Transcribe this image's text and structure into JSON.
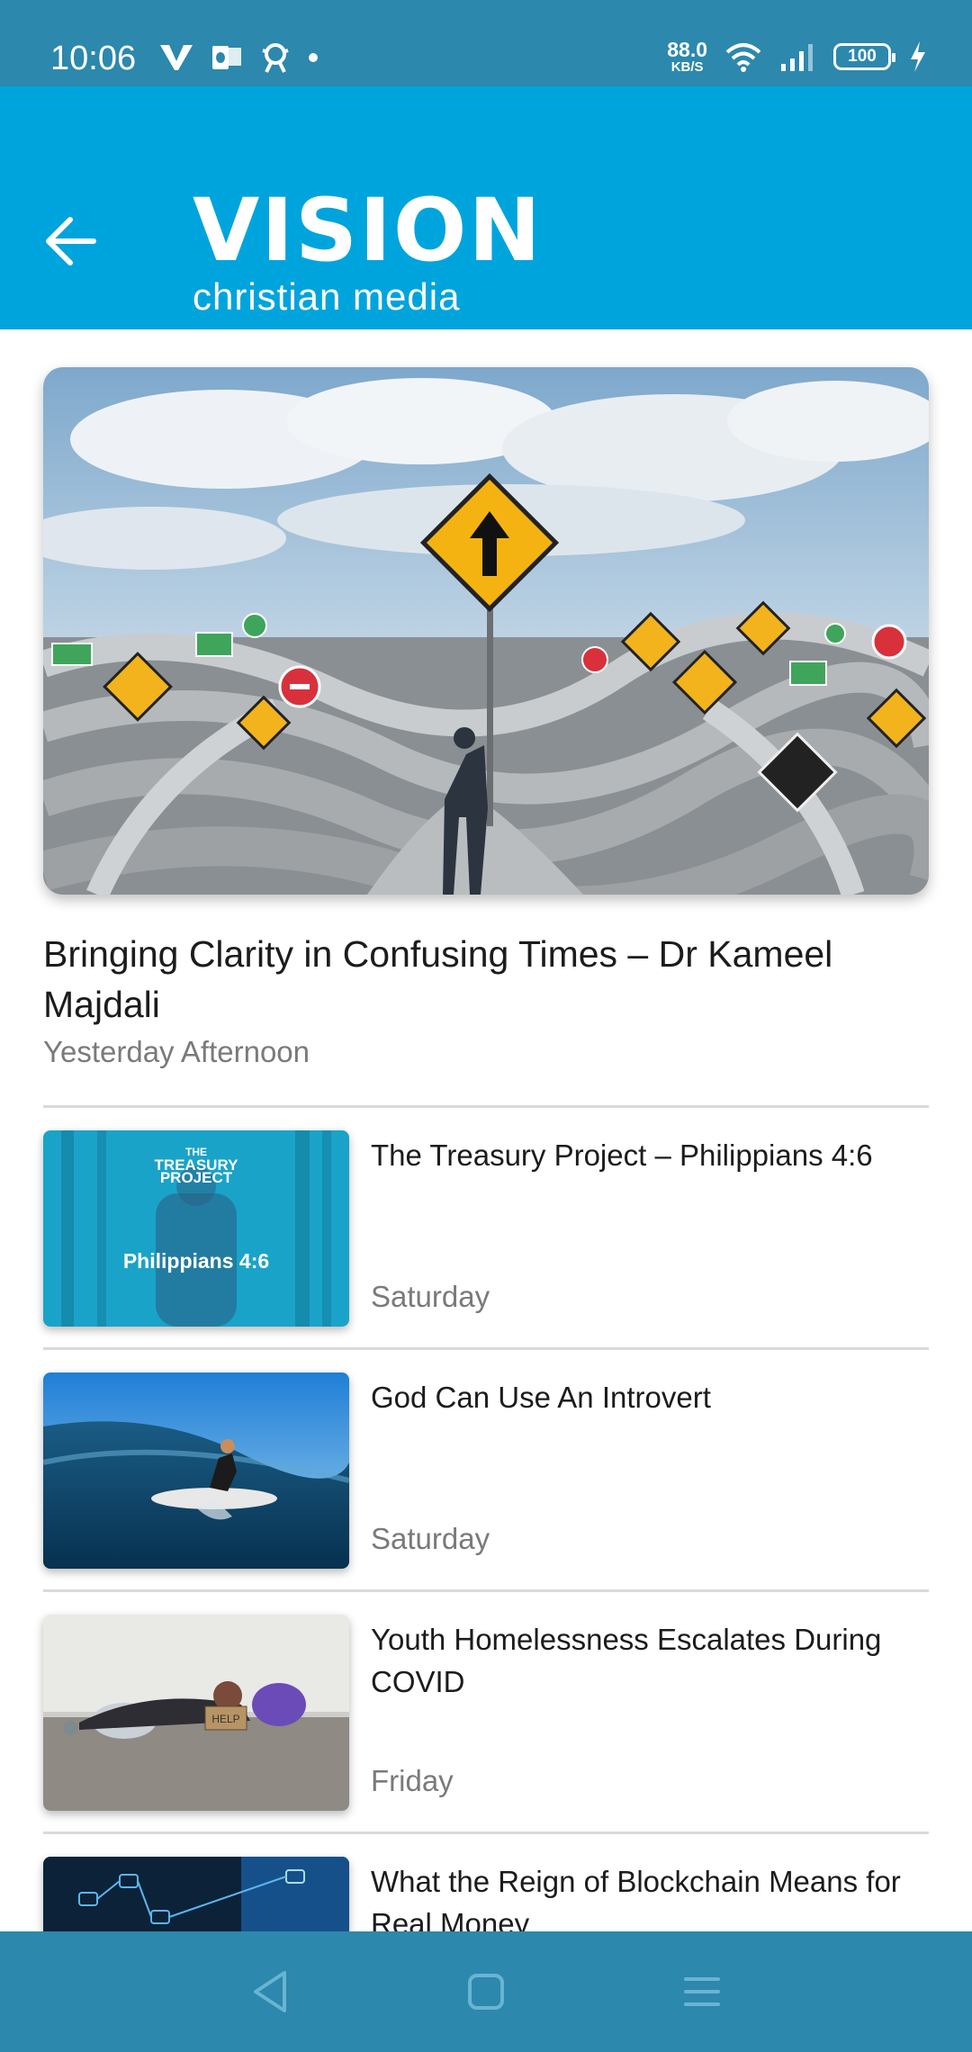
{
  "status_bar": {
    "time": "10:06",
    "speed_value": "88.0",
    "speed_unit": "KB/S",
    "battery": "100"
  },
  "app_bar": {
    "logo_main": "VISION",
    "logo_sub": "christian media",
    "back_icon": "arrow-left-icon"
  },
  "featured": {
    "title": "Bringing Clarity in Confusing Times – Dr Kameel Majdali",
    "date": "Yesterday Afternoon"
  },
  "articles": [
    {
      "title": "The Treasury Project – Philippians 4:6",
      "date": "Saturday",
      "thumb_heading_line1": "THE",
      "thumb_heading_line2": "TREASURY",
      "thumb_heading_line3": "PROJECT",
      "thumb_caption": "Philippians 4:6"
    },
    {
      "title": "God Can Use An Introvert",
      "date": "Saturday"
    },
    {
      "title": "Youth Homelessness Escalates During COVID",
      "date": "Friday",
      "thumb_sign": "HELP"
    },
    {
      "title": "What the Reign of Blockchain Means for Real Money",
      "date": ""
    }
  ],
  "colors": {
    "status_bar": "#2c88ad",
    "app_bar": "#00a4dc",
    "nav_bar": "#2c88ad",
    "title_text": "#1c1c1c",
    "date_text": "#7a7a7a"
  },
  "nav_bar": {
    "back_icon": "triangle-back-icon",
    "home_icon": "square-home-icon",
    "menu_icon": "lines-menu-icon"
  }
}
